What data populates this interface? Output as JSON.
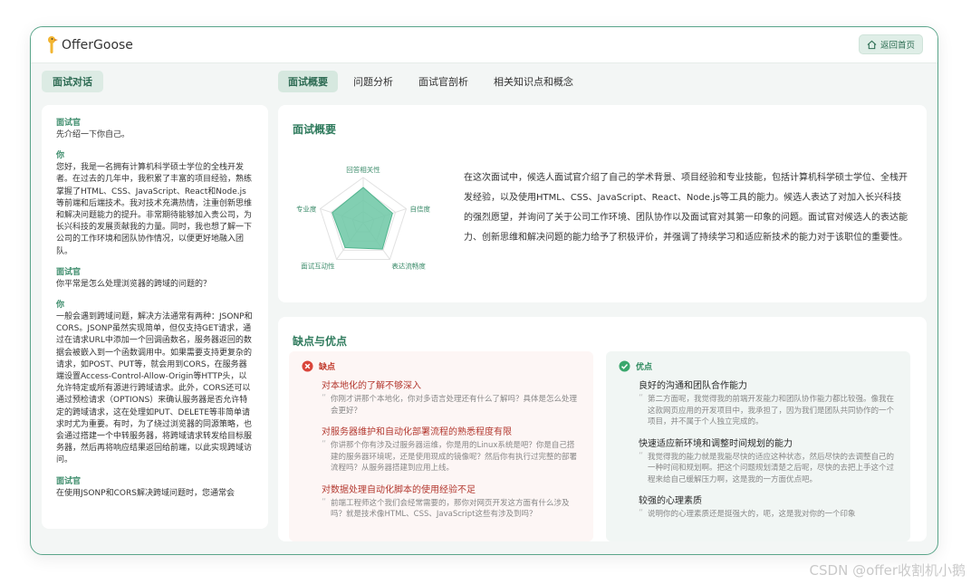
{
  "app": {
    "name": "OfferGoose",
    "home_label": "返回首页"
  },
  "left_panel": {
    "title": "面试对话"
  },
  "tabs": [
    {
      "label": "面试概要",
      "active": true
    },
    {
      "label": "问题分析",
      "active": false
    },
    {
      "label": "面试官剖析",
      "active": false
    },
    {
      "label": "相关知识点和概念",
      "active": false
    }
  ],
  "chat": [
    {
      "who": "面试官",
      "text": "先介绍一下你自己。"
    },
    {
      "who": "你",
      "text": "您好，我是一名拥有计算机科学硕士学位的全栈开发者。在过去的几年中，我积累了丰富的项目经验，熟练掌握了HTML、CSS、JavaScript、React和Node.js等前端和后端技术。我对技术充满热情，注重创新思维和解决问题能力的提升。非常期待能够加入贵公司，为长兴科技的发展贡献我的力量。同时，我也想了解一下公司的工作环境和团队协作情况，以便更好地融入团队。"
    },
    {
      "who": "面试官",
      "text": "你平常是怎么处理浏览器的跨域的问题的？"
    },
    {
      "who": "你",
      "text": "一般会遇到跨域问题，解决方法通常有两种：JSONP和CORS。JSONP虽然实现简单，但仅支持GET请求，通过在请求URL中添加一个回调函数名，服务器返回的数据会被嵌入到一个函数调用中。如果需要支持更复杂的请求，如POST、PUT等，就会用到CORS，在服务器端设置Access-Control-Allow-Origin等HTTP头，以允许特定或所有源进行跨域请求。此外，CORS还可以通过预检请求（OPTIONS）来确认服务器是否允许特定的跨域请求，这在处理如PUT、DELETE等非简单请求时尤为重要。有时，为了绕过浏览器的同源策略，也会通过搭建一个中转服务器，将跨域请求转发给目标服务器，然后再将响应结果返回给前端，以此实现跨域访问。"
    },
    {
      "who": "面试官",
      "text": "在使用JSONP和CORS解决跨域问题时，您通常会"
    }
  ],
  "overview": {
    "title": "面试概要",
    "radar": {
      "axes": [
        "回答相关性",
        "自信度",
        "表达流畅度",
        "面试互动性",
        "专业度"
      ],
      "values": [
        0.78,
        0.68,
        0.72,
        0.68,
        0.72
      ],
      "color": "#6cc7a5"
    },
    "summary": "在这次面试中，候选人面试官介绍了自己的学术背景、项目经验和专业技能，包括计算机科学硕士学位、全栈开发经验，以及使用HTML、CSS、JavaScript、React、Node.js等工具的能力。候选人表达了对加入长兴科技的强烈愿望，并询问了关于公司工作环境、团队协作以及面试官对其第一印象的问题。面试官对候选人的表达能力、创新思维和解决问题的能力给予了积极评价，并强调了持续学习和适应新技术的能力对于该职位的重要性。"
  },
  "pros_cons": {
    "title": "缺点与优点",
    "cons_label": "缺点",
    "pros_label": "优点",
    "cons": [
      {
        "title": "对本地化的了解不够深入",
        "desc": "你刚才讲那个本地化，你对多语言处理还有什么了解吗？具体是怎么处理会更好？"
      },
      {
        "title": "对服务器维护和自动化部署流程的熟悉程度有限",
        "desc": "你讲那个你有涉及过服务器运维，你是用的Linux系统是吧？你是自己搭建的服务器环境呢，还是使用现成的镜像呢？然后你有执行过完整的部署流程吗？从服务器搭建到应用上线。"
      },
      {
        "title": "对数据处理自动化脚本的使用经验不足",
        "desc": "前端工程师这个我们会经常需要的，那你对网页开发这方面有什么涉及吗？就是技术像HTML、CSS、JavaScript这些有涉及到吗？"
      }
    ],
    "pros": [
      {
        "title": "良好的沟通和团队合作能力",
        "desc": "第二方面呢，我觉得我的前端开发能力和团队协作能力都比较强。像我在这款网页应用的开发项目中，我承担了，因为我们是团队共同协作的一个项目，并不属于个人独立完成的。"
      },
      {
        "title": "快速适应新环境和调整时间规划的能力",
        "desc": "我觉得我的能力就是我能尽快的适应这种状态，然后尽快的去调整自己的一种时间和规划啊。把这个问题规划清楚之后呢，尽快的去把上手这个过程来给自己缓解压力啊，这是我的一方面优点吧。"
      },
      {
        "title": "较强的心理素质",
        "desc": "说明你的心理素质还是挺强大的，呃，这是我对你的一个印象"
      }
    ]
  },
  "watermark": "CSDN @offer收割机小鹅"
}
